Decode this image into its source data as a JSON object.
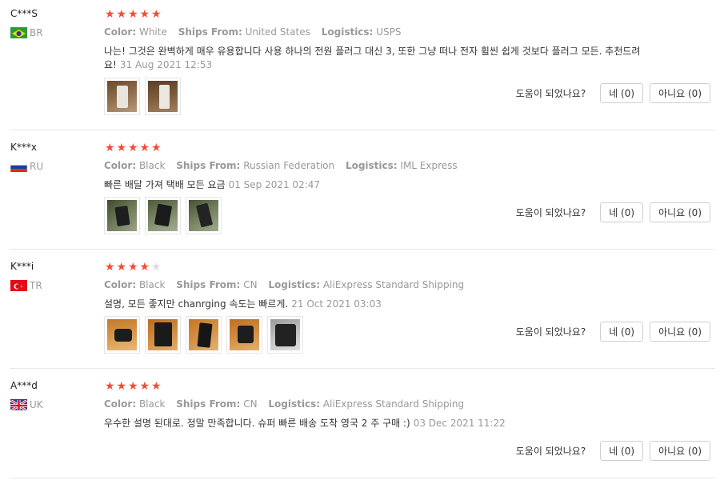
{
  "labels": {
    "color": "Color:",
    "ships_from": "Ships From:",
    "logistics": "Logistics:",
    "helpful": "도움이 되었나요?",
    "yes": "네 (0)",
    "no": "아니요 (0)"
  },
  "reviews": [
    {
      "user": "C***S",
      "country": "BR",
      "flag": "flag-brazil",
      "rating": 5,
      "color": "White",
      "ships_from": "United States",
      "logistics": "USPS",
      "text": "나는! 그것은 완벽하게 매우 유용합니다 사용 하나의 전원 플러그 대신 3, 또한 그냥 떠나 전자 휠씬 쉽게 것보다 플러그 모든. 추천드려요!",
      "date": "31 Aug 2021 12:53",
      "photos": 2
    },
    {
      "user": "K***x",
      "country": "RU",
      "flag": "flag-russia",
      "rating": 5,
      "color": "Black",
      "ships_from": "Russian Federation",
      "logistics": "IML Express",
      "text": "빠른 배달 가져 택배 모든 요금",
      "date": "01 Sep 2021 02:47",
      "photos": 3
    },
    {
      "user": "K***i",
      "country": "TR",
      "flag": "flag-turkey",
      "rating": 4,
      "color": "Black",
      "ships_from": "CN",
      "logistics": "AliExpress Standard Shipping",
      "text": "설명, 모든 좋지만 chanrging 속도는 빠르게.",
      "date": "21 Oct 2021 03:03",
      "photos": 5
    },
    {
      "user": "A***d",
      "country": "UK",
      "flag": "flag-uk",
      "rating": 5,
      "color": "Black",
      "ships_from": "CN",
      "logistics": "AliExpress Standard Shipping",
      "text": "우수한 설명 된대로. 정말 만족합니다. 슈퍼 빠른 배송 도착 영국 2 주 구매 :)",
      "date": "03 Dec 2021 11:22",
      "photos": 0
    }
  ]
}
